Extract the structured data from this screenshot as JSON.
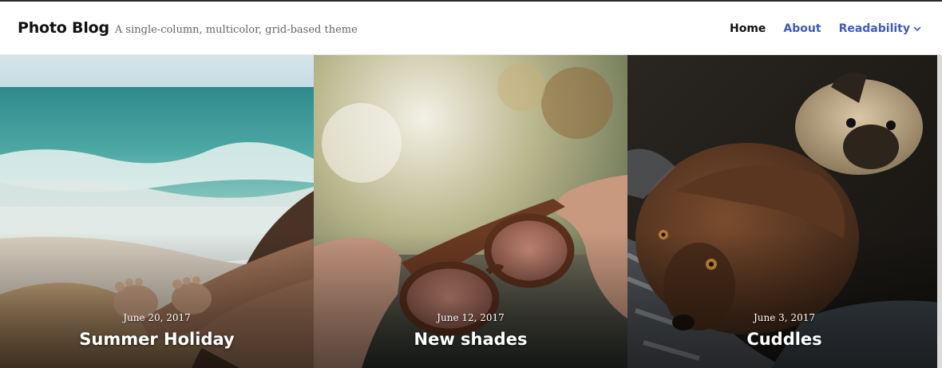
{
  "site": {
    "title": "Photo Blog",
    "tagline": "A single-column, multicolor, grid-based theme"
  },
  "nav": {
    "items": [
      {
        "label": "Home"
      },
      {
        "label": "About"
      },
      {
        "label": "Readability"
      }
    ]
  },
  "posts": [
    {
      "date": "June 20, 2017",
      "title": "Summer Holiday",
      "image": "beach-feet-photo"
    },
    {
      "date": "June 12, 2017",
      "title": "New shades",
      "image": "sunglasses-photo"
    },
    {
      "date": "June 3, 2017",
      "title": "Cuddles",
      "image": "dogs-photo"
    }
  ],
  "colors": {
    "accent": "#3d5bc0",
    "text": "#111111",
    "muted": "#666666"
  }
}
